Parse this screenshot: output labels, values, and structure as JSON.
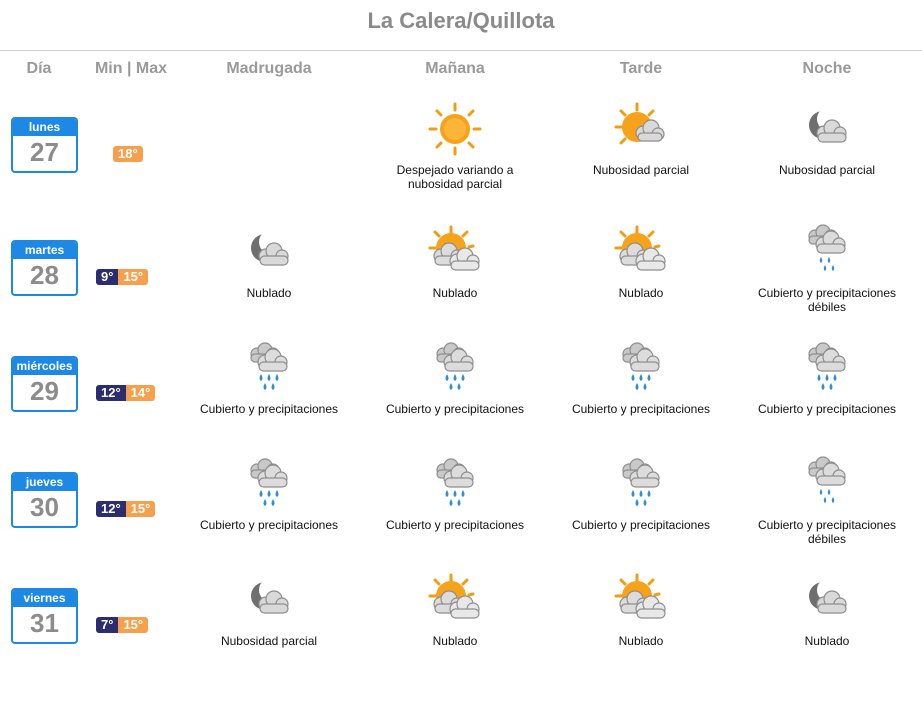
{
  "title": "La Calera/Quillota",
  "headers": {
    "dia": "Día",
    "minmax": "Min | Max",
    "madrugada": "Madrugada",
    "manana": "Mañana",
    "tarde": "Tarde",
    "noche": "Noche"
  },
  "colors": {
    "calendar": "#1e88e5",
    "min_badge": "#2b2d6e",
    "max_badge": "#f6a04d",
    "title": "#8a8a8a"
  },
  "days": [
    {
      "name": "lunes",
      "num": "27",
      "min": "",
      "max": "18°",
      "periods": [
        null,
        {
          "icon": "sun-icon",
          "desc": "Despejado variando a nubosidad parcial"
        },
        {
          "icon": "sun-cloud-icon",
          "desc": "Nubosidad parcial"
        },
        {
          "icon": "moon-cloud-icon",
          "desc": "Nubosidad parcial"
        }
      ]
    },
    {
      "name": "martes",
      "num": "28",
      "min": "9°",
      "max": "15°",
      "periods": [
        {
          "icon": "moon-cloud-icon",
          "desc": "Nublado"
        },
        {
          "icon": "sun-clouds-icon",
          "desc": "Nublado"
        },
        {
          "icon": "sun-clouds-icon",
          "desc": "Nublado"
        },
        {
          "icon": "light-rain-icon",
          "desc": "Cubierto y precipitaciones débiles"
        }
      ]
    },
    {
      "name": "miércoles",
      "num": "29",
      "min": "12°",
      "max": "14°",
      "periods": [
        {
          "icon": "rain-icon",
          "desc": "Cubierto y precipitaciones"
        },
        {
          "icon": "rain-icon",
          "desc": "Cubierto y precipitaciones"
        },
        {
          "icon": "rain-icon",
          "desc": "Cubierto y precipitaciones"
        },
        {
          "icon": "rain-icon",
          "desc": "Cubierto y precipitaciones"
        }
      ]
    },
    {
      "name": "jueves",
      "num": "30",
      "min": "12°",
      "max": "15°",
      "periods": [
        {
          "icon": "rain-icon",
          "desc": "Cubierto y precipitaciones"
        },
        {
          "icon": "rain-icon",
          "desc": "Cubierto y precipitaciones"
        },
        {
          "icon": "rain-icon",
          "desc": "Cubierto y precipitaciones"
        },
        {
          "icon": "light-rain-icon",
          "desc": "Cubierto y precipitaciones débiles"
        }
      ]
    },
    {
      "name": "viernes",
      "num": "31",
      "min": "7°",
      "max": "15°",
      "periods": [
        {
          "icon": "moon-cloud-icon",
          "desc": "Nubosidad parcial"
        },
        {
          "icon": "sun-clouds-icon",
          "desc": "Nublado"
        },
        {
          "icon": "sun-clouds-icon",
          "desc": "Nublado"
        },
        {
          "icon": "moon-cloud-icon",
          "desc": "Nublado"
        }
      ]
    }
  ]
}
